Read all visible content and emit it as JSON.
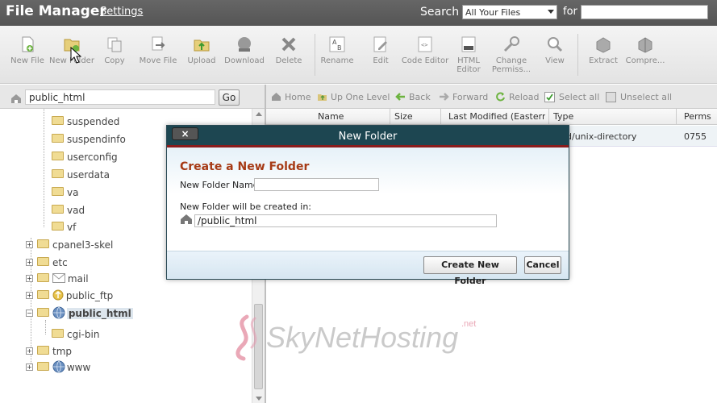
{
  "header": {
    "title": "File Manager",
    "settings_link": "Settings",
    "search_label": "Search",
    "search_scope": "All Your Files",
    "for_label": "for",
    "search_query": ""
  },
  "toolbar": {
    "items": [
      {
        "label": "New File",
        "icon": "new-file-icon"
      },
      {
        "label": "New Folder",
        "icon": "new-folder-icon"
      },
      {
        "label": "Copy",
        "icon": "copy-icon"
      },
      {
        "label": "Move File",
        "icon": "move-file-icon"
      },
      {
        "label": "Upload",
        "icon": "upload-icon"
      },
      {
        "label": "Download",
        "icon": "download-icon"
      },
      {
        "label": "Delete",
        "icon": "delete-icon"
      },
      {
        "label": "Rename",
        "icon": "rename-icon"
      },
      {
        "label": "Edit",
        "icon": "edit-icon"
      },
      {
        "label": "Code Editor",
        "icon": "code-editor-icon"
      },
      {
        "label": "HTML Editor",
        "icon": "html-editor-icon"
      },
      {
        "label": "Change Permiss...",
        "icon": "change-permissions-icon"
      },
      {
        "label": "View",
        "icon": "view-icon"
      },
      {
        "label": "Extract",
        "icon": "extract-icon"
      },
      {
        "label": "Compre...",
        "icon": "compress-icon"
      }
    ]
  },
  "left_panel": {
    "path_value": "public_html",
    "go_label": "Go",
    "tree": [
      {
        "label": "suspended"
      },
      {
        "label": "suspendinfo"
      },
      {
        "label": "userconfig"
      },
      {
        "label": "userdata"
      },
      {
        "label": "va"
      },
      {
        "label": "vad"
      },
      {
        "label": "vf"
      },
      {
        "label": "cpanel3-skel"
      },
      {
        "label": "etc"
      },
      {
        "label": "mail"
      },
      {
        "label": "public_ftp"
      },
      {
        "label": "public_html"
      },
      {
        "label": "cgi-bin"
      },
      {
        "label": "tmp"
      },
      {
        "label": "www"
      }
    ]
  },
  "right_panel": {
    "toolbar": {
      "home": "Home",
      "up_one_level": "Up One Level",
      "back": "Back",
      "forward": "Forward",
      "reload": "Reload",
      "select_all": "Select all",
      "unselect_all": "Unselect all"
    },
    "columns": [
      "Name",
      "Size",
      "Last Modified (Eastern Da",
      "Type",
      "Perms"
    ],
    "row": {
      "type": "d/unix-directory",
      "perms": "0755"
    }
  },
  "dialog": {
    "title": "New Folder",
    "close_label": "×",
    "heading": "Create a New Folder",
    "name_label": "New Folder Name:",
    "name_value": "",
    "location_label": "New Folder will be created in:",
    "location_value": "/public_html",
    "create_button": "Create New Folder",
    "cancel_button": "Cancel"
  },
  "watermark": {
    "text": "SkyNetHosting",
    "suffix": ".net"
  },
  "colors": {
    "header_bg": "#5c5c5c",
    "dialog_titlebar": "#1d4651",
    "dialog_accent": "#8a1c1c",
    "heading_color": "#a63a15",
    "folder_yellow": "#f0dc94",
    "watermark_pink": "#d9627d"
  }
}
